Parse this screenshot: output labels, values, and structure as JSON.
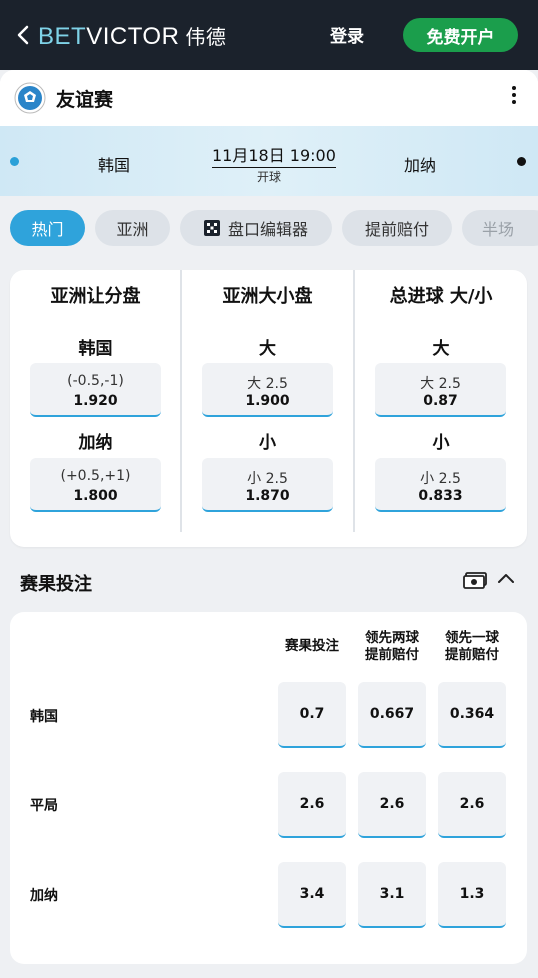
{
  "header": {
    "brand_bet": "BET",
    "brand_victor": "VICTOR",
    "brand_cn": "伟德",
    "login_label": "登录",
    "register_label": "免费开户"
  },
  "event": {
    "competition": "友谊赛",
    "home_team": "韩国",
    "away_team": "加纳",
    "kickoff_datetime": "11月18日 19:00",
    "kickoff_label": "开球"
  },
  "tabs": [
    {
      "label": "热门",
      "active": true
    },
    {
      "label": "亚洲",
      "active": false
    },
    {
      "label": "盘口编辑器",
      "active": false,
      "icon": "grid-icon"
    },
    {
      "label": "提前赔付",
      "active": false
    },
    {
      "label": "半场",
      "active": false
    }
  ],
  "markets": [
    {
      "title": "亚洲让分盘",
      "selections": [
        {
          "label": "韩国",
          "line": "(-0.5,-1)",
          "price": "1.920"
        },
        {
          "label": "加纳",
          "line": "(+0.5,+1)",
          "price": "1.800"
        }
      ]
    },
    {
      "title": "亚洲大小盘",
      "selections": [
        {
          "label": "大",
          "line": "大 2.5",
          "price": "1.900"
        },
        {
          "label": "小",
          "line": "小 2.5",
          "price": "1.870"
        }
      ]
    },
    {
      "title": "总进球 大/小",
      "selections": [
        {
          "label": "大",
          "line": "大 2.5",
          "price": "0.87"
        },
        {
          "label": "小",
          "line": "小 2.5",
          "price": "0.833"
        }
      ]
    }
  ],
  "result_section": {
    "title": "赛果投注",
    "columns": [
      "赛果投注",
      "领先两球\n提前赔付",
      "领先一球\n提前赔付"
    ],
    "columns_line1": [
      "赛果投注",
      "领先两球",
      "领先一球"
    ],
    "columns_line2": [
      "",
      "提前赔付",
      "提前赔付"
    ],
    "rows": [
      {
        "label": "韩国",
        "odds": [
          "0.7",
          "0.667",
          "0.364"
        ]
      },
      {
        "label": "平局",
        "odds": [
          "2.6",
          "2.6",
          "2.6"
        ]
      },
      {
        "label": "加纳",
        "odds": [
          "3.4",
          "3.1",
          "1.3"
        ]
      }
    ]
  },
  "colors": {
    "topbar": "#1b222c",
    "register_green": "#1b9e4c",
    "accent_blue": "#2fa3db",
    "brand_cyan": "#7fd3e8"
  }
}
